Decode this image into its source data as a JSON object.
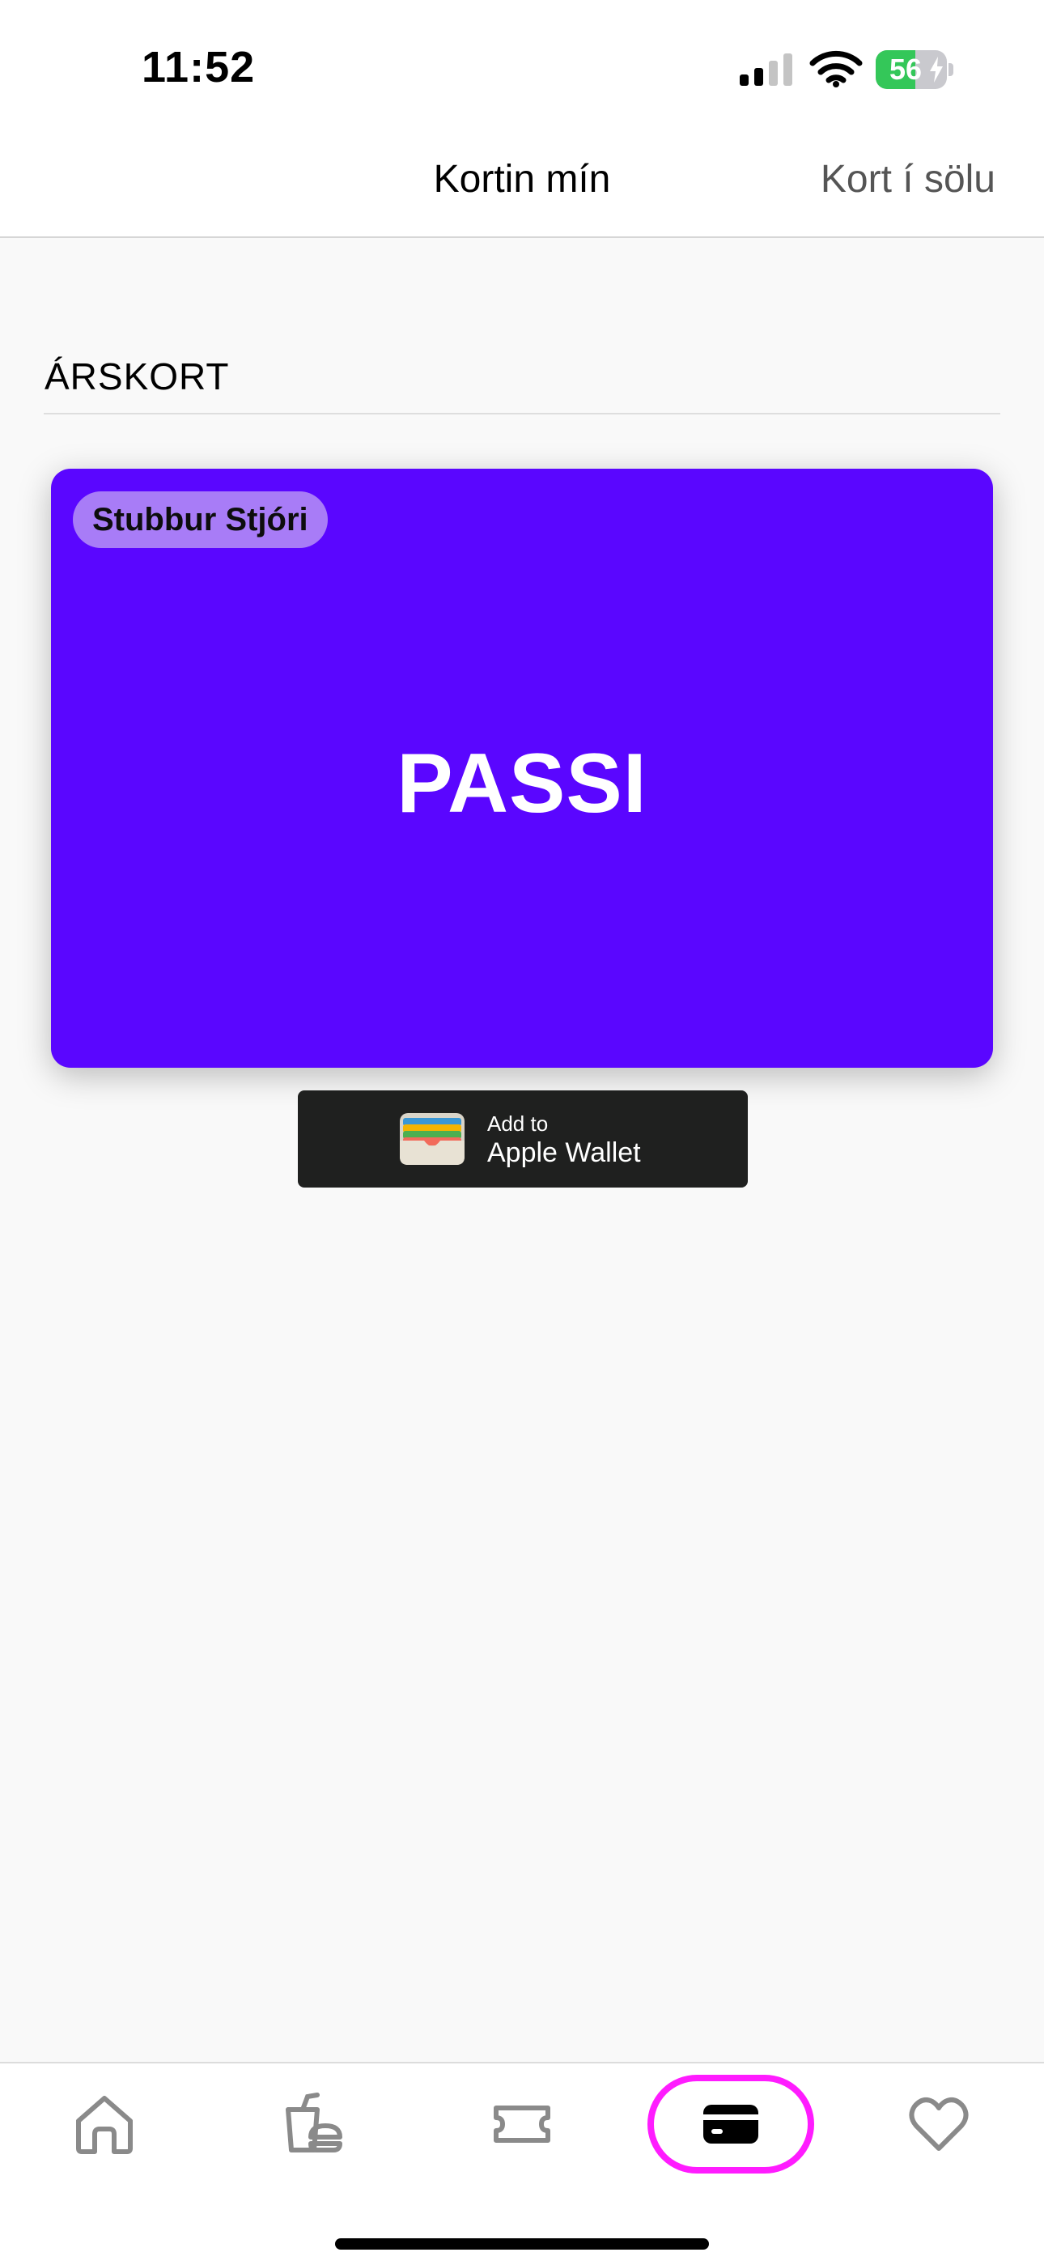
{
  "status_bar": {
    "time": "11:52",
    "battery_level": "56",
    "battery_fraction": 0.56,
    "battery_color": "#34c759",
    "icons": [
      "signal-icon",
      "wifi-icon",
      "battery-charging-icon"
    ]
  },
  "header": {
    "title": "Kortin mín",
    "action_label": "Kort í sölu"
  },
  "section": {
    "title": "ÁRSKORT"
  },
  "pass_card": {
    "holder": "Stubbur Stjóri",
    "name": "PASSI",
    "color": "#5a06ff",
    "badge_color": "#a87cf7"
  },
  "wallet_button": {
    "line1": "Add to",
    "line2": "Apple Wallet",
    "icon": "wallet-icon"
  },
  "tab_bar": {
    "active": "cards",
    "highlight_color": "#ff1cff",
    "tabs": [
      {
        "id": "home",
        "icon": "home-icon"
      },
      {
        "id": "food",
        "icon": "drink-food-icon"
      },
      {
        "id": "tickets",
        "icon": "ticket-icon"
      },
      {
        "id": "cards",
        "icon": "card-icon"
      },
      {
        "id": "favorites",
        "icon": "heart-icon"
      }
    ]
  }
}
